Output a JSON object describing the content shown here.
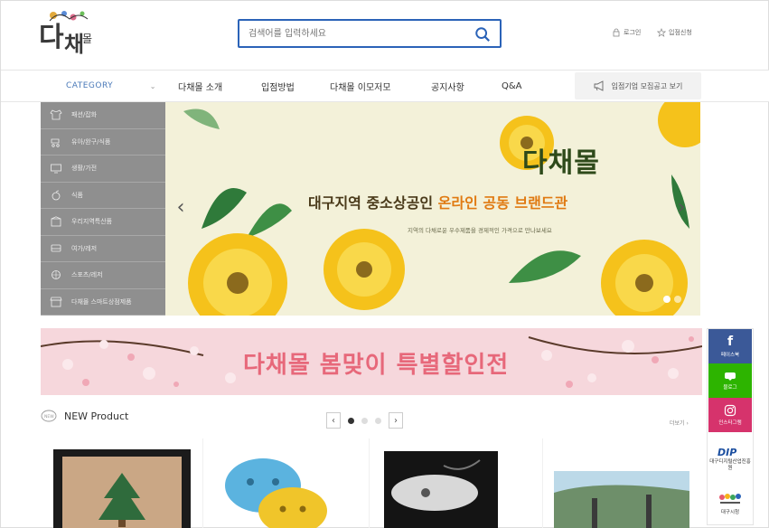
{
  "header": {
    "search_placeholder": "검색어를 입력하세요",
    "login_label": "로그인",
    "join_label": "입점신청"
  },
  "nav": {
    "category_label": "CATEGORY",
    "items": [
      "다채몰 소개",
      "입점방법",
      "다채몰 이모저모",
      "공지사항",
      "Q&A"
    ],
    "recruit_label": "입점기업 모집공고 보기"
  },
  "sidebar": {
    "items": [
      "패션/잡화",
      "유아/완구/식품",
      "생활/가전",
      "식품",
      "우리지역특산품",
      "여가/레저",
      "스포츠/레저",
      "다채몰 스마트상점제품"
    ]
  },
  "hero": {
    "title": "다채몰",
    "subtitle_part1": "대구지역 중소상공인 ",
    "subtitle_highlight": "온라인 공동 브랜드관",
    "small_text": "지역의 다채로운 우수제품을 경제적인 가격으로 만나보세요"
  },
  "promo": {
    "text": "다채몰 봄맞이 특별할인전"
  },
  "quick_menu": {
    "facebook_label": "페이스북",
    "blog_label": "블로그",
    "instagram_label": "인스타그램",
    "dip_label": "대구디지털산업진흥원",
    "colorful_label": "대구시청"
  },
  "new_product": {
    "title": "NEW Product",
    "more_label": "더보기"
  },
  "colors": {
    "accent": "#2b63b8",
    "sidebar_bg": "#8f8f8f",
    "promo_bg": "#f6d7dc",
    "facebook": "#3b5998",
    "blog": "#2db400",
    "instagram": "#d6336c"
  }
}
